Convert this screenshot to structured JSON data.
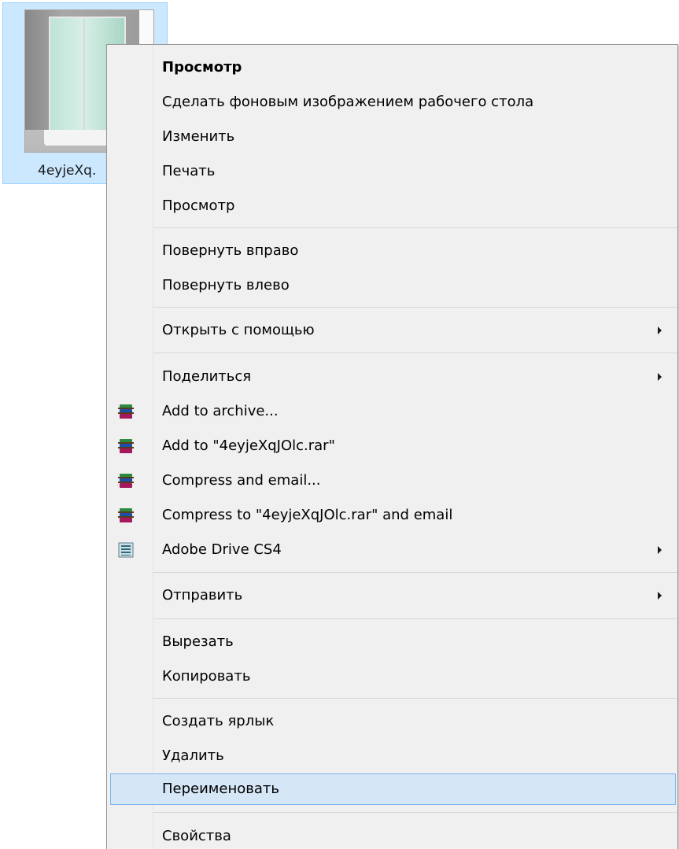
{
  "file": {
    "label": "4eyjeXq."
  },
  "menu": {
    "items": [
      {
        "label": "Просмотр",
        "bold": true
      },
      {
        "label": "Сделать фоновым изображением рабочего стола"
      },
      {
        "label": "Изменить"
      },
      {
        "label": "Печать"
      },
      {
        "label": "Просмотр"
      },
      {
        "label": "Повернуть вправо"
      },
      {
        "label": "Повернуть влево"
      },
      {
        "label": "Открыть с помощью",
        "submenu": true
      },
      {
        "label": "Поделиться",
        "submenu": true
      },
      {
        "label": "Add to archive...",
        "icon": "winrar-icon"
      },
      {
        "label": "Add to \"4eyjeXqJOlc.rar\"",
        "icon": "winrar-icon"
      },
      {
        "label": "Compress and email...",
        "icon": "winrar-icon"
      },
      {
        "label": "Compress to \"4eyjeXqJOlc.rar\" and email",
        "icon": "winrar-icon"
      },
      {
        "label": "Adobe Drive CS4",
        "icon": "adobe-drive-icon",
        "submenu": true
      },
      {
        "label": "Отправить",
        "submenu": true
      },
      {
        "label": "Вырезать"
      },
      {
        "label": "Копировать"
      },
      {
        "label": "Создать ярлык"
      },
      {
        "label": "Удалить"
      },
      {
        "label": "Переименовать",
        "highlighted": true
      },
      {
        "label": "Свойства"
      }
    ]
  },
  "colors": {
    "menu_background": "#f0f0f0",
    "highlight": "#d5e6f6",
    "highlight_border": "#7eb4ea",
    "selection": "#cce8ff"
  }
}
